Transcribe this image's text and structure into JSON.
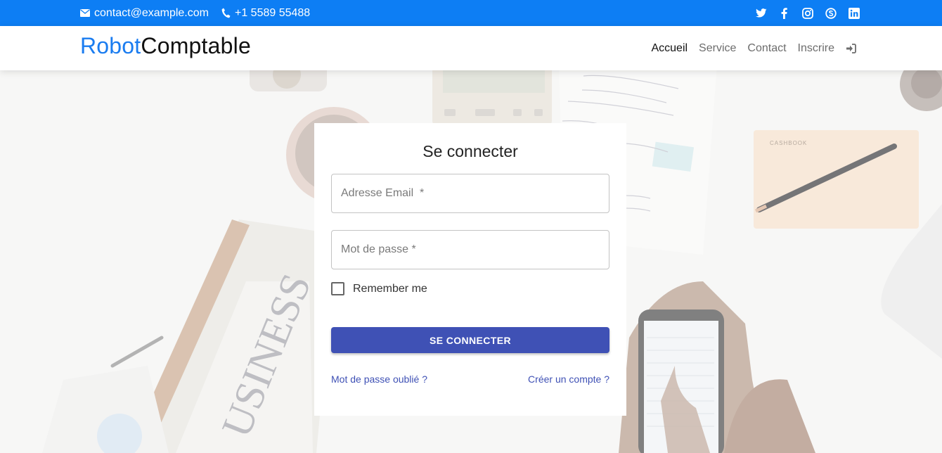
{
  "topbar": {
    "email": "contact@example.com",
    "phone": "+1 5589 55488",
    "social": [
      "twitter-icon",
      "facebook-icon",
      "instagram-icon",
      "skype-icon",
      "linkedin-icon"
    ],
    "background": "#0d7ef4"
  },
  "brand": {
    "part1": "Robot",
    "part2": "Comptable",
    "accent": "#1a7cf0"
  },
  "nav": {
    "items": [
      {
        "label": "Accueil",
        "active": true
      },
      {
        "label": "Service",
        "active": false
      },
      {
        "label": "Contact",
        "active": false
      },
      {
        "label": "Inscrire",
        "active": false
      }
    ],
    "login_icon": "sign-in-icon"
  },
  "login": {
    "title": "Se connecter",
    "email_placeholder": "Adresse Email  *",
    "email_value": "",
    "password_placeholder": "Mot de passe *",
    "password_value": "",
    "remember_label": "Remember me",
    "remember_checked": false,
    "submit_label": "SE CONNECTER",
    "forgot_label": "Mot de passe oublié ?",
    "create_label": "Créer un compte ?",
    "button_color": "#3f51b5"
  }
}
